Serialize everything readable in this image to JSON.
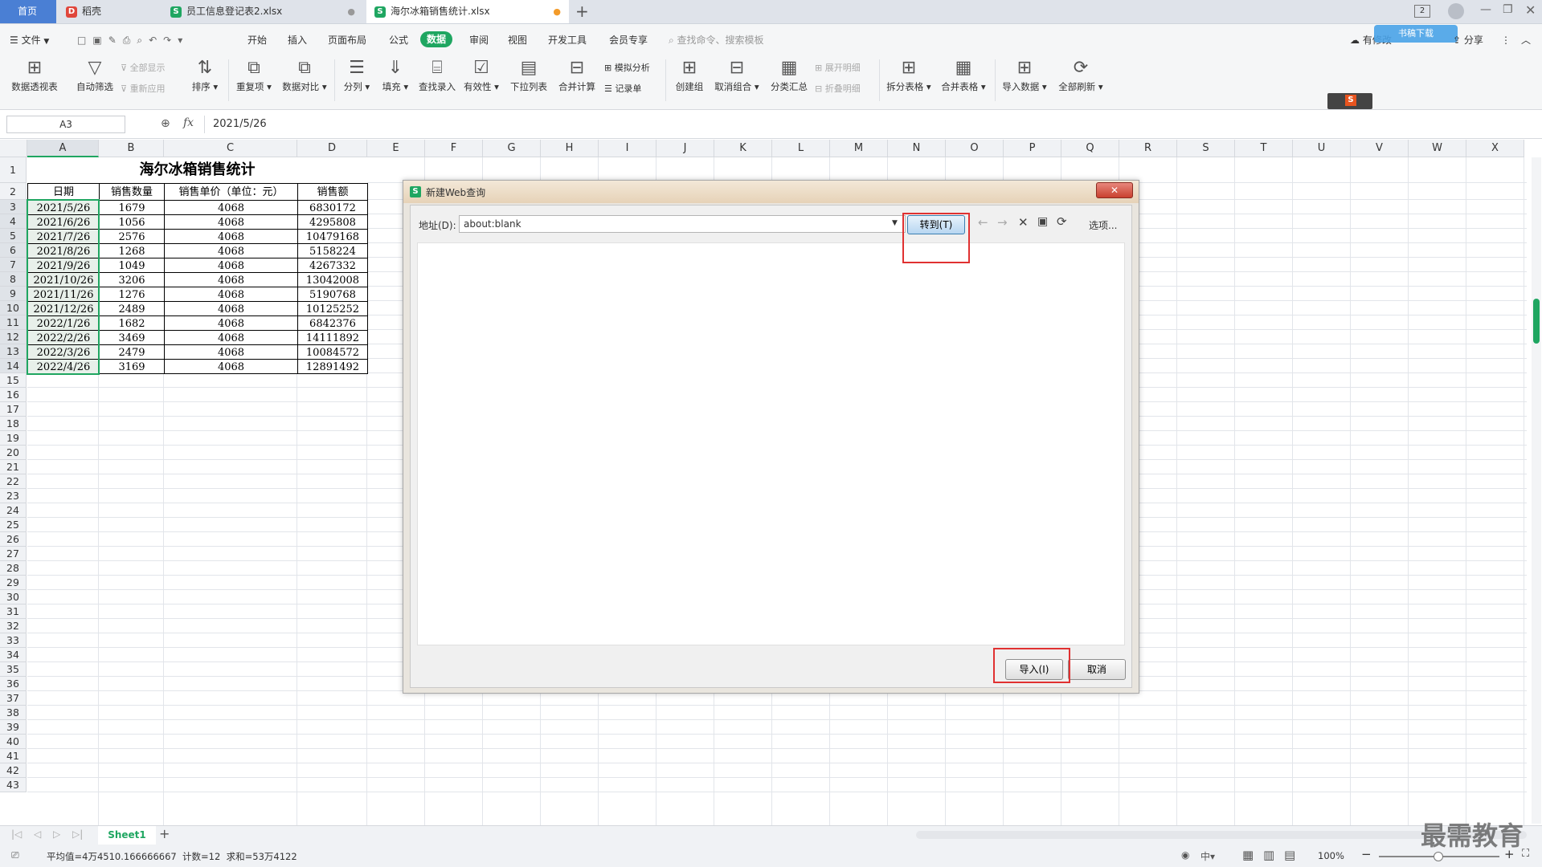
{
  "tabs": [
    {
      "label": "首页",
      "active": false
    },
    {
      "label": "稻壳",
      "active": false
    },
    {
      "label": "员工信息登记表2.xlsx",
      "active": false
    },
    {
      "label": "海尔冰箱销售统计.xlsx",
      "active": true
    }
  ],
  "window_controls": {
    "badge": "2"
  },
  "menu": {
    "file": "文件",
    "items": [
      "开始",
      "插入",
      "页面布局",
      "公式",
      "数据",
      "审阅",
      "视图",
      "开发工具",
      "会员专享"
    ],
    "active": "数据",
    "search_placeholder": "查找命令、搜索模板",
    "right": [
      "有修改",
      "分享"
    ],
    "cloud_badge": "书稿下载"
  },
  "ribbon": {
    "pivot": "数据透视表",
    "autofilter": "自动筛选",
    "show_all": "全部显示",
    "reapply": "重新应用",
    "sort": "排序",
    "duplicates": "重复项",
    "compare": "数据对比",
    "split": "分列",
    "fill": "填充",
    "lookup": "查找录入",
    "validity": "有效性",
    "dropdown": "下拉列表",
    "consolidate": "合并计算",
    "what_if": "模拟分析",
    "record": "记录单",
    "group": "创建组",
    "ungroup": "取消组合",
    "subtotal": "分类汇总",
    "expand": "展开明细",
    "collapse": "折叠明细",
    "split_table": "拆分表格",
    "merge_table": "合并表格",
    "import": "导入数据",
    "refresh": "全部刷新"
  },
  "formula_bar": {
    "name_box": "A3",
    "fx": "fx",
    "value": "2021/5/26"
  },
  "columns": [
    "A",
    "B",
    "C",
    "D",
    "E",
    "F",
    "G",
    "H",
    "I",
    "J",
    "K",
    "L",
    "M",
    "N",
    "O",
    "P",
    "Q",
    "R",
    "S",
    "T",
    "U",
    "V",
    "W",
    "X"
  ],
  "rows": [
    "1",
    "2",
    "3",
    "4",
    "5",
    "6",
    "7",
    "8",
    "9",
    "10",
    "11",
    "12",
    "13",
    "14",
    "15",
    "16",
    "17",
    "18",
    "19",
    "20",
    "21",
    "22",
    "23",
    "24",
    "25",
    "26",
    "27",
    "28",
    "29",
    "30",
    "31",
    "32",
    "33",
    "34",
    "35",
    "36",
    "37",
    "38",
    "39",
    "40",
    "41",
    "42",
    "43"
  ],
  "sheet": {
    "title": "海尔冰箱销售统计",
    "headers": [
      "日期",
      "销售数量",
      "销售单价（单位：元）",
      "销售额"
    ],
    "data": [
      [
        "2021/5/26",
        "1679",
        "4068",
        "6830172"
      ],
      [
        "2021/6/26",
        "1056",
        "4068",
        "4295808"
      ],
      [
        "2021/7/26",
        "2576",
        "4068",
        "10479168"
      ],
      [
        "2021/8/26",
        "1268",
        "4068",
        "5158224"
      ],
      [
        "2021/9/26",
        "1049",
        "4068",
        "4267332"
      ],
      [
        "2021/10/26",
        "3206",
        "4068",
        "13042008"
      ],
      [
        "2021/11/26",
        "1276",
        "4068",
        "5190768"
      ],
      [
        "2021/12/26",
        "2489",
        "4068",
        "10125252"
      ],
      [
        "2022/1/26",
        "1682",
        "4068",
        "6842376"
      ],
      [
        "2022/2/26",
        "3469",
        "4068",
        "14111892"
      ],
      [
        "2022/3/26",
        "2479",
        "4068",
        "10084572"
      ],
      [
        "2022/4/26",
        "3169",
        "4068",
        "12891492"
      ]
    ]
  },
  "dialog": {
    "title": "新建Web查询",
    "address_label": "地址(D):",
    "address_value": "about:blank",
    "go": "转到(T)",
    "options": "选项...",
    "import": "导入(I)",
    "cancel": "取消"
  },
  "sheet_tabs": {
    "active": "Sheet1",
    "add": "+"
  },
  "status": {
    "stats": "平均值=4万4510.166666667  计数=12  求和=53万4122",
    "zoom": "100%",
    "watermark": "最需教育"
  }
}
